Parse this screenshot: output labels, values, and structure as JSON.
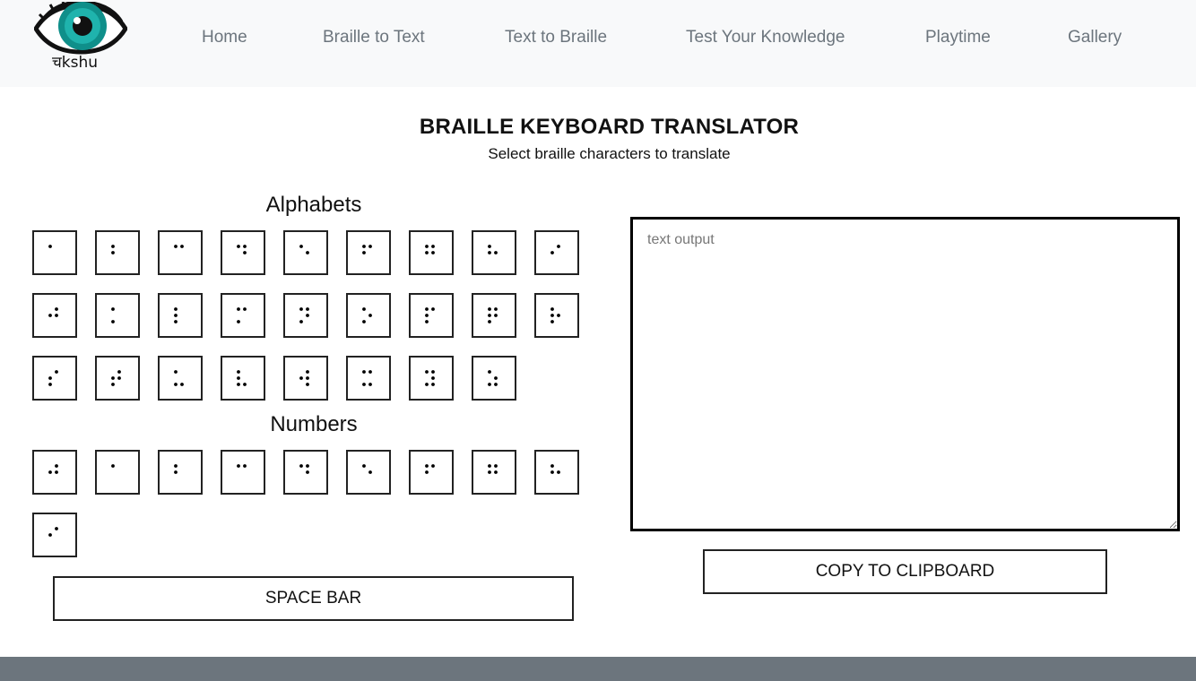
{
  "brand": {
    "logo_text": "चkshu",
    "accent": "#0f8f8a"
  },
  "nav": {
    "links": [
      "Home",
      "Braille to Text",
      "Text to Braille",
      "Test Your Knowledge",
      "Playtime",
      "Gallery"
    ]
  },
  "page": {
    "title": "BRAILLE KEYBOARD TRANSLATOR",
    "subtitle": "Select braille characters to translate"
  },
  "keyboard": {
    "alphabets_heading": "Alphabets",
    "numbers_heading": "Numbers",
    "alphabet_dots": [
      [
        1
      ],
      [
        1,
        2
      ],
      [
        1,
        4
      ],
      [
        1,
        4,
        5
      ],
      [
        1,
        5
      ],
      [
        1,
        2,
        4
      ],
      [
        1,
        2,
        4,
        5
      ],
      [
        1,
        2,
        5
      ],
      [
        2,
        4
      ],
      [
        2,
        4,
        5
      ],
      [
        1,
        3
      ],
      [
        1,
        2,
        3
      ],
      [
        1,
        3,
        4
      ],
      [
        1,
        3,
        4,
        5
      ],
      [
        1,
        3,
        5
      ],
      [
        1,
        2,
        3,
        4
      ],
      [
        1,
        2,
        3,
        4,
        5
      ],
      [
        1,
        2,
        3,
        5
      ],
      [
        2,
        3,
        4
      ],
      [
        2,
        3,
        4,
        5
      ],
      [
        1,
        3,
        6
      ],
      [
        1,
        2,
        3,
        6
      ],
      [
        2,
        4,
        5,
        6
      ],
      [
        1,
        3,
        4,
        6
      ],
      [
        1,
        3,
        4,
        5,
        6
      ],
      [
        1,
        3,
        5,
        6
      ]
    ],
    "number_dots": [
      [
        2,
        4,
        5
      ],
      [
        1
      ],
      [
        1,
        2
      ],
      [
        1,
        4
      ],
      [
        1,
        4,
        5
      ],
      [
        1,
        5
      ],
      [
        1,
        2,
        4
      ],
      [
        1,
        2,
        4,
        5
      ],
      [
        1,
        2,
        5
      ],
      [
        2,
        4
      ]
    ],
    "space_label": "SPACE BAR"
  },
  "output": {
    "placeholder": "text output",
    "value": "",
    "copy_label": "COPY TO CLIPBOARD"
  },
  "colors": {
    "navbar_bg": "#f8f9fa",
    "nav_text": "#6c757d",
    "footer_bg": "#6c757d"
  }
}
